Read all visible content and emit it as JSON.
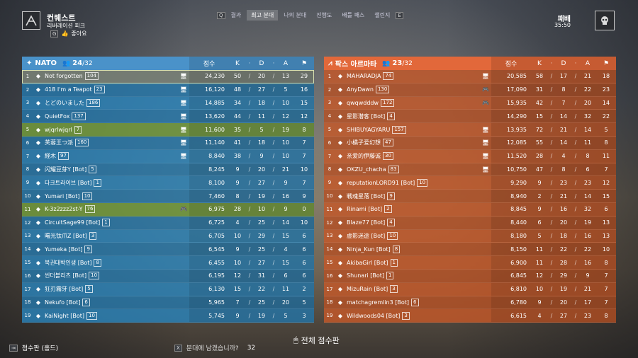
{
  "header": {
    "mode_name": "컨퀘스트",
    "map_name": "리버레이션 피크",
    "like_key": "G",
    "like_label": "좋아요",
    "tabs": [
      {
        "key": "Q",
        "label": ""
      },
      {
        "label": "결과"
      },
      {
        "label": "최고 분대"
      },
      {
        "label": "나의 분대"
      },
      {
        "label": "진행도"
      },
      {
        "label": "배틀 패스"
      },
      {
        "label": "챌린지"
      },
      {
        "key": "E",
        "label": ""
      }
    ],
    "active_tab": 2,
    "result": "패배",
    "timer": "35:50"
  },
  "teams": [
    {
      "name": "NATO",
      "players": "24",
      "max": "/32",
      "color": "#4a92c9",
      "columns": {
        "score": "점수",
        "k": "K",
        "d": "D",
        "a": "A"
      },
      "rows": [
        {
          "rank": "1",
          "name": "Not forgotten",
          "lvl": "104",
          "plat": "pc",
          "score": "24,230",
          "k": "50",
          "d": "20",
          "a": "13",
          "obj": "29",
          "state": "me"
        },
        {
          "rank": "2",
          "name": "418 I'm a Teapot",
          "lvl": "23",
          "plat": "pc",
          "score": "16,120",
          "k": "48",
          "d": "27",
          "a": "5",
          "obj": "16"
        },
        {
          "rank": "3",
          "name": "とどのいました",
          "lvl": "186",
          "plat": "pc",
          "score": "14,885",
          "k": "34",
          "d": "18",
          "a": "10",
          "obj": "15"
        },
        {
          "rank": "4",
          "name": "QuietFox",
          "lvl": "137",
          "plat": "pc",
          "score": "13,620",
          "k": "44",
          "d": "11",
          "a": "12",
          "obj": "12"
        },
        {
          "rank": "5",
          "name": "wjqrlwjqrl",
          "lvl": "7",
          "plat": "pc",
          "score": "11,600",
          "k": "35",
          "d": "5",
          "a": "19",
          "obj": "8",
          "state": "squad"
        },
        {
          "rank": "6",
          "name": "芙蓉王つ派",
          "lvl": "160",
          "plat": "pc",
          "score": "11,140",
          "k": "41",
          "d": "18",
          "a": "10",
          "obj": "7"
        },
        {
          "rank": "7",
          "name": "経木",
          "lvl": "97",
          "plat": "pc",
          "score": "8,840",
          "k": "38",
          "d": "9",
          "a": "10",
          "obj": "7"
        },
        {
          "rank": "8",
          "name": "闪耀豆芽Y [Bot]",
          "lvl": "5",
          "plat": "",
          "score": "8,245",
          "k": "9",
          "d": "20",
          "a": "21",
          "obj": "10"
        },
        {
          "rank": "9",
          "name": "다크트라이브 [Bot]",
          "lvl": "1",
          "plat": "",
          "score": "8,100",
          "k": "9",
          "d": "27",
          "a": "9",
          "obj": "7"
        },
        {
          "rank": "10",
          "name": "Yumari [Bot]",
          "lvl": "10",
          "plat": "",
          "score": "7,460",
          "k": "8",
          "d": "19",
          "a": "16",
          "obj": "9"
        },
        {
          "rank": "11",
          "name": "K-3z2zzz2st-Y",
          "lvl": "76",
          "plat": "controller",
          "score": "6,975",
          "k": "28",
          "d": "10",
          "a": "9",
          "obj": "0",
          "state": "squad"
        },
        {
          "rank": "12",
          "name": "CircuitSage99 [Bot]",
          "lvl": "1",
          "plat": "",
          "score": "6,725",
          "k": "4",
          "d": "25",
          "a": "14",
          "obj": "10"
        },
        {
          "rank": "13",
          "name": "曙光钛爪Z [Bot]",
          "lvl": "3",
          "plat": "",
          "score": "6,705",
          "k": "10",
          "d": "29",
          "a": "15",
          "obj": "6"
        },
        {
          "rank": "14",
          "name": "Yumeka [Bot]",
          "lvl": "9",
          "plat": "",
          "score": "6,545",
          "k": "9",
          "d": "25",
          "a": "4",
          "obj": "6"
        },
        {
          "rank": "15",
          "name": "북권대박인생 [Bot]",
          "lvl": "8",
          "plat": "",
          "score": "6,455",
          "k": "10",
          "d": "27",
          "a": "15",
          "obj": "6"
        },
        {
          "rank": "16",
          "name": "씬더블리츠 [Bot]",
          "lvl": "10",
          "plat": "",
          "score": "6,195",
          "k": "12",
          "d": "31",
          "a": "6",
          "obj": "6"
        },
        {
          "rank": "17",
          "name": "狂刃霧牙 [Bot]",
          "lvl": "5",
          "plat": "",
          "score": "6,130",
          "k": "15",
          "d": "22",
          "a": "11",
          "obj": "2"
        },
        {
          "rank": "18",
          "name": "Nekufo [Bot]",
          "lvl": "6",
          "plat": "",
          "score": "5,965",
          "k": "7",
          "d": "25",
          "a": "20",
          "obj": "5"
        },
        {
          "rank": "19",
          "name": "KaiNight [Bot]",
          "lvl": "10",
          "plat": "",
          "score": "5,745",
          "k": "9",
          "d": "19",
          "a": "5",
          "obj": "3"
        }
      ]
    },
    {
      "name": "팍스 아르마타",
      "players": "23",
      "max": "/32",
      "color": "#e2683a",
      "columns": {
        "score": "점수",
        "k": "K",
        "d": "D",
        "a": "A"
      },
      "rows": [
        {
          "rank": "1",
          "name": "MAHARADJA",
          "lvl": "74",
          "plat": "pc",
          "score": "20,585",
          "k": "58",
          "d": "17",
          "a": "21",
          "obj": "18"
        },
        {
          "rank": "2",
          "name": "AnyDawn",
          "lvl": "130",
          "plat": "controller",
          "score": "17,090",
          "k": "31",
          "d": "8",
          "a": "22",
          "obj": "23"
        },
        {
          "rank": "3",
          "name": "qwqwdddw",
          "lvl": "172",
          "plat": "controller",
          "score": "15,935",
          "k": "42",
          "d": "7",
          "a": "20",
          "obj": "14"
        },
        {
          "rank": "4",
          "name": "星影潜客 [Bot]",
          "lvl": "4",
          "plat": "",
          "score": "14,290",
          "k": "15",
          "d": "14",
          "a": "32",
          "obj": "22"
        },
        {
          "rank": "5",
          "name": "SHIBUYAGYARU",
          "lvl": "157",
          "plat": "pc",
          "score": "13,935",
          "k": "72",
          "d": "21",
          "a": "14",
          "obj": "5"
        },
        {
          "rank": "6",
          "name": "小橘子爱幻想",
          "lvl": "47",
          "plat": "pc",
          "score": "12,085",
          "k": "55",
          "d": "14",
          "a": "11",
          "obj": "8"
        },
        {
          "rank": "7",
          "name": "亲爱的伊藤诚",
          "lvl": "30",
          "plat": "pc",
          "score": "11,520",
          "k": "28",
          "d": "4",
          "a": "8",
          "obj": "11"
        },
        {
          "rank": "8",
          "name": "OKZU_chacha",
          "lvl": "83",
          "plat": "pc",
          "score": "10,750",
          "k": "47",
          "d": "8",
          "a": "6",
          "obj": "7"
        },
        {
          "rank": "9",
          "name": "reputationLORD91 [Bot]",
          "lvl": "10",
          "plat": "",
          "score": "9,290",
          "k": "9",
          "d": "23",
          "a": "23",
          "obj": "12"
        },
        {
          "rank": "10",
          "name": "戦魂星落 [Bot]",
          "lvl": "9",
          "plat": "",
          "score": "8,940",
          "k": "2",
          "d": "21",
          "a": "14",
          "obj": "15"
        },
        {
          "rank": "11",
          "name": "Rinami [Bot]",
          "lvl": "2",
          "plat": "",
          "score": "8,845",
          "k": "9",
          "d": "16",
          "a": "32",
          "obj": "6"
        },
        {
          "rank": "12",
          "name": "Blaze77 [Bot]",
          "lvl": "4",
          "plat": "",
          "score": "8,440",
          "k": "6",
          "d": "20",
          "a": "19",
          "obj": "13"
        },
        {
          "rank": "13",
          "name": "虚影迷途 [Bot]",
          "lvl": "10",
          "plat": "",
          "score": "8,180",
          "k": "5",
          "d": "18",
          "a": "16",
          "obj": "13"
        },
        {
          "rank": "14",
          "name": "Ninja_Kun [Bot]",
          "lvl": "8",
          "plat": "",
          "score": "8,150",
          "k": "11",
          "d": "22",
          "a": "22",
          "obj": "10"
        },
        {
          "rank": "15",
          "name": "AkibaGirl [Bot]",
          "lvl": "1",
          "plat": "",
          "score": "6,900",
          "k": "11",
          "d": "28",
          "a": "16",
          "obj": "8"
        },
        {
          "rank": "16",
          "name": "Shunari [Bot]",
          "lvl": "1",
          "plat": "",
          "score": "6,845",
          "k": "12",
          "d": "29",
          "a": "9",
          "obj": "7"
        },
        {
          "rank": "17",
          "name": "MizuRain [Bot]",
          "lvl": "3",
          "plat": "",
          "score": "6,810",
          "k": "10",
          "d": "19",
          "a": "21",
          "obj": "7"
        },
        {
          "rank": "18",
          "name": "matchagremlin3 [Bot]",
          "lvl": "6",
          "plat": "",
          "score": "6,780",
          "k": "9",
          "d": "20",
          "a": "17",
          "obj": "7"
        },
        {
          "rank": "19",
          "name": "Wildwoods04 [Bot]",
          "lvl": "3",
          "plat": "",
          "score": "6,615",
          "k": "4",
          "d": "27",
          "a": "23",
          "obj": "8"
        }
      ]
    }
  ],
  "footer": {
    "full_scoreboard": "전체 점수판",
    "scoreboard_hold": "점수판 (홀드)",
    "squad_prompt_key": "X",
    "squad_prompt": "분대에 남겠습니까?",
    "squad_prompt_count": "32"
  }
}
